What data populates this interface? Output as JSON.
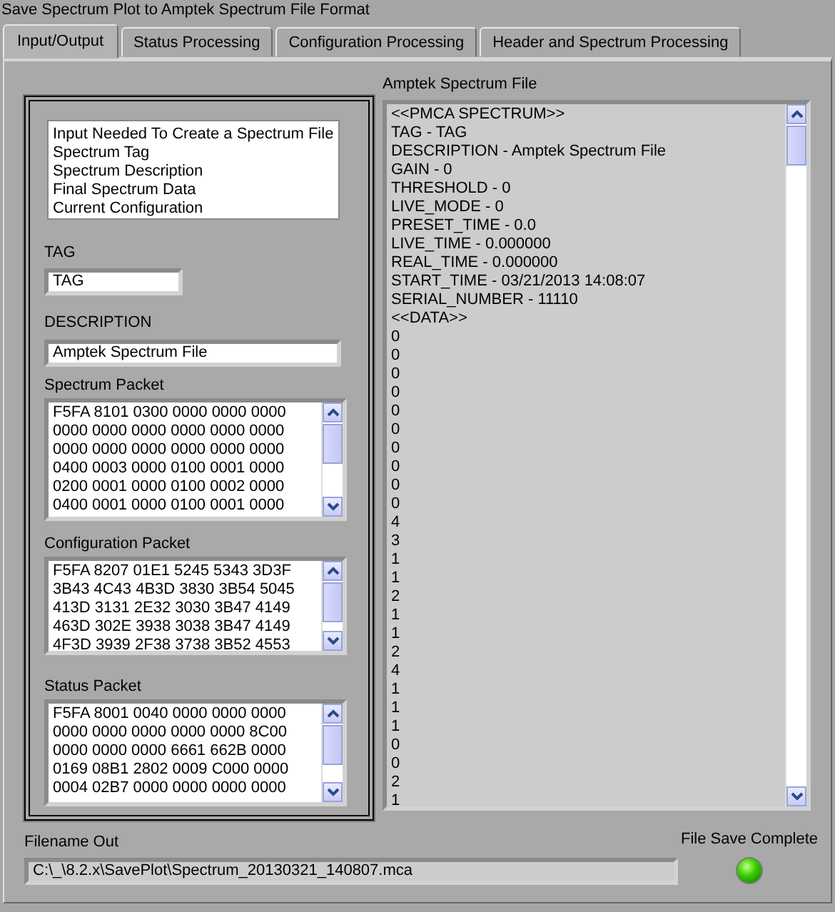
{
  "window": {
    "title": "Save Spectrum Plot to Amptek Spectrum File Format"
  },
  "tabs": [
    {
      "label": "Input/Output",
      "selected": true
    },
    {
      "label": "Status Processing",
      "selected": false
    },
    {
      "label": "Configuration Processing",
      "selected": false
    },
    {
      "label": "Header and Spectrum Processing",
      "selected": false
    }
  ],
  "inputs_list": {
    "items": [
      "Input Needed To Create a Spectrum File",
      "Spectrum Tag",
      "Spectrum Description",
      "Final Spectrum Data",
      "Current Configuration"
    ]
  },
  "tag": {
    "label": "TAG",
    "value": "TAG"
  },
  "description": {
    "label": "DESCRIPTION",
    "value": "Amptek Spectrum File"
  },
  "packets": [
    {
      "label": "Spectrum Packet",
      "lines": [
        "F5FA 8101 0300 0000 0000 0000",
        "0000 0000 0000 0000 0000 0000",
        "0000 0000 0000 0000 0000 0000",
        "0400 0003 0000 0100 0001 0000",
        "0200 0001 0000 0100 0002 0000",
        "0400 0001 0000 0100 0001 0000"
      ]
    },
    {
      "label": "Configuration Packet",
      "lines": [
        "F5FA 8207 01E1 5245 5343 3D3F",
        "3B43 4C43 4B3D 3830 3B54 5045",
        "413D 3131 2E32 3030 3B47 4149",
        "463D 302E 3938 3038 3B47 4149",
        "4F3D 3939 2F38 3738 3B52 4553"
      ]
    },
    {
      "label": "Status Packet",
      "lines": [
        "F5FA 8001 0040 0000 0000 0000",
        "0000 0000 0000 0000 0000 8C00",
        "0000 0000 0000 6661 662B 0000",
        "0169 08B1 2802 0009 C000 0000",
        "0004 02B7 0000 0000 0000 0000"
      ]
    }
  ],
  "spectrum_file": {
    "label": "Amptek Spectrum File",
    "lines": [
      "<<PMCA SPECTRUM>>",
      "TAG - TAG",
      "DESCRIPTION - Amptek Spectrum File",
      "GAIN - 0",
      "THRESHOLD - 0",
      "LIVE_MODE - 0",
      "PRESET_TIME - 0.0",
      "LIVE_TIME - 0.000000",
      "REAL_TIME - 0.000000",
      "START_TIME - 03/21/2013 14:08:07",
      "SERIAL_NUMBER - 11110",
      "<<DATA>>",
      "0",
      "0",
      "0",
      "0",
      "0",
      "0",
      "0",
      "0",
      "0",
      "0",
      "4",
      "3",
      "1",
      "1",
      "2",
      "1",
      "1",
      "2",
      "4",
      "1",
      "1",
      "1",
      "0",
      "0",
      "2",
      "1"
    ]
  },
  "filename_out": {
    "label": "Filename Out",
    "value": "C:\\_\\8.2.x\\SavePlot\\Spectrum_20130321_140807.mca"
  },
  "file_save_complete": {
    "label": "File Save Complete",
    "on": true
  }
}
